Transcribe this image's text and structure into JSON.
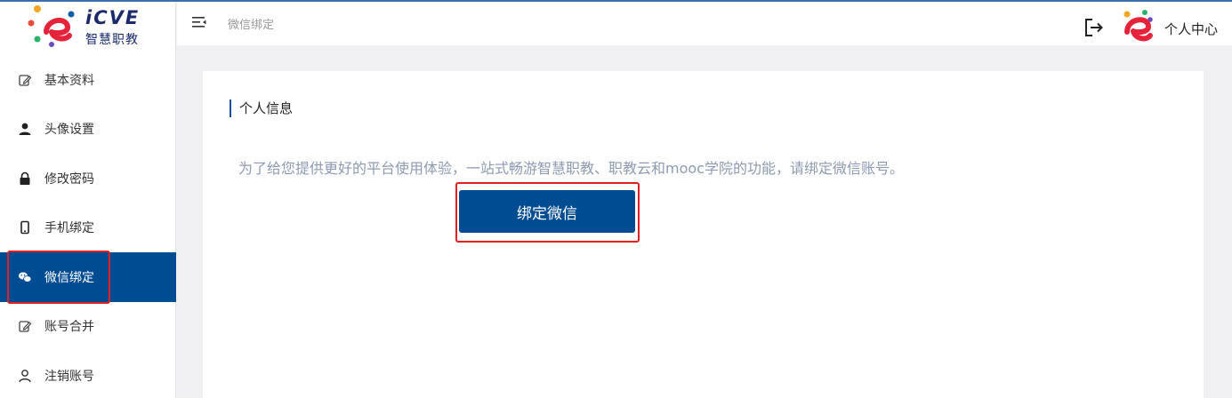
{
  "logo": {
    "text_en": "iCVE",
    "text_cn": "智慧职教"
  },
  "sidebar": {
    "items": [
      {
        "label": "基本资料",
        "icon": "edit-icon"
      },
      {
        "label": "头像设置",
        "icon": "user-icon"
      },
      {
        "label": "修改密码",
        "icon": "lock-icon"
      },
      {
        "label": "手机绑定",
        "icon": "phone-icon"
      },
      {
        "label": "微信绑定",
        "icon": "wechat-icon",
        "active": true
      },
      {
        "label": "账号合并",
        "icon": "edit-icon"
      },
      {
        "label": "注销账号",
        "icon": "user-outline-icon"
      }
    ]
  },
  "header": {
    "breadcrumb": "微信绑定",
    "user_center": "个人中心"
  },
  "main": {
    "section_title": "个人信息",
    "description": "为了给您提供更好的平台使用体验，一站式畅游智慧职教、职教云和mooc学院的功能，请绑定微信账号。",
    "bind_button": "绑定微信"
  },
  "colors": {
    "primary": "#004c93",
    "highlight": "#e02020",
    "desc_text": "#8d9ab1"
  }
}
